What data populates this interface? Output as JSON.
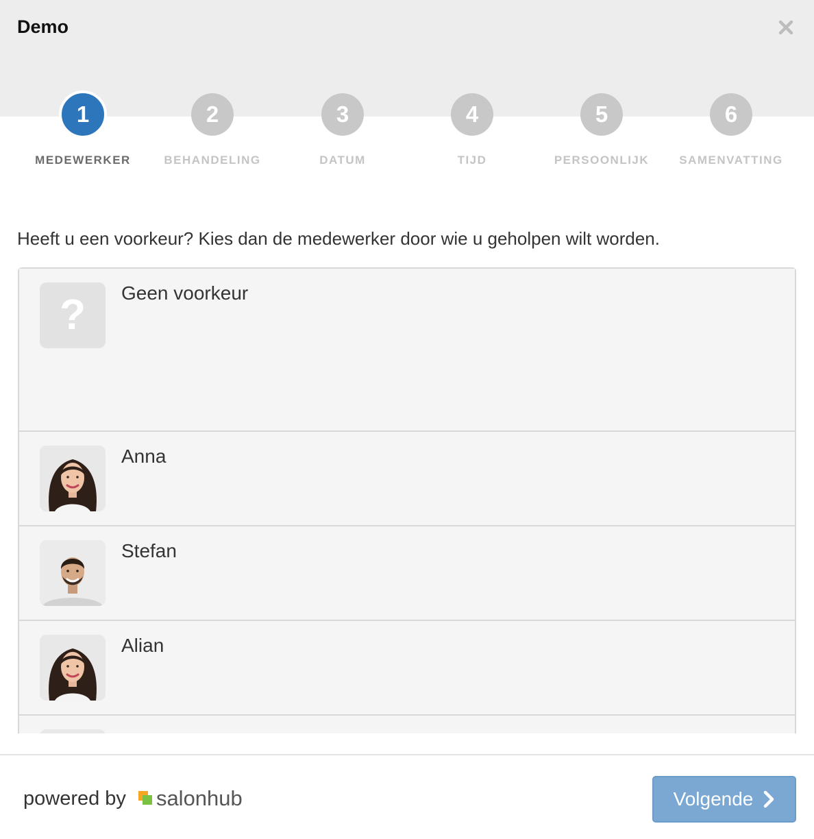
{
  "app": {
    "title": "Demo"
  },
  "steps": [
    {
      "number": "1",
      "label": "MEDEWERKER",
      "active": true
    },
    {
      "number": "2",
      "label": "BEHANDELING",
      "active": false
    },
    {
      "number": "3",
      "label": "DATUM",
      "active": false
    },
    {
      "number": "4",
      "label": "TIJD",
      "active": false
    },
    {
      "number": "5",
      "label": "PERSOONLIJK",
      "active": false
    },
    {
      "number": "6",
      "label": "SAMENVATTING",
      "active": false
    }
  ],
  "intro": "Heeft u een voorkeur? Kies dan de medewerker door wie u geholpen wilt worden.",
  "staff": [
    {
      "name": "Geen voorkeur",
      "avatar": "question-mark"
    },
    {
      "name": "Anna",
      "avatar": "photo-woman"
    },
    {
      "name": "Stefan",
      "avatar": "photo-man"
    },
    {
      "name": "Alian",
      "avatar": "photo-woman"
    }
  ],
  "footer": {
    "powered_by": "powered by",
    "brand": "salonhub",
    "next_button": "Volgende"
  },
  "colors": {
    "active_step": "#2e76bb",
    "inactive_step": "#c8c8c8",
    "next_button": "#7aa8d2",
    "brand_orange": "#f5a623",
    "brand_green": "#7cc242"
  }
}
